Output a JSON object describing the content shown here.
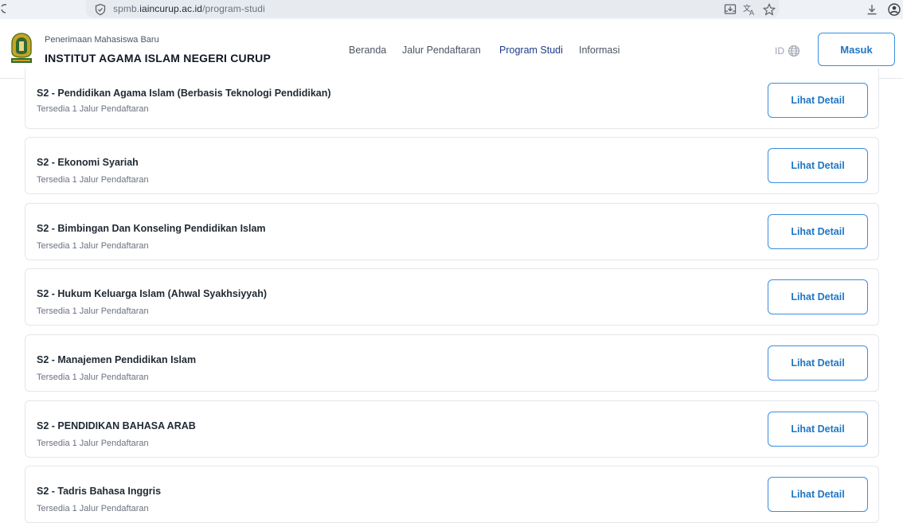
{
  "browser": {
    "url_prefix": "spmb.",
    "url_domain": "iaincurup.ac.id",
    "url_path": "/program-studi"
  },
  "header": {
    "subtitle": "Penerimaan Mahasiswa Baru",
    "brand": "INSTITUT AGAMA ISLAM NEGERI CURUP",
    "nav": [
      "Beranda",
      "Jalur Pendaftaran",
      "Program Studi",
      "Informasi"
    ],
    "active_nav": "Program Studi",
    "lang": "ID",
    "login_label": "Masuk"
  },
  "programs": [
    {
      "title": "S2 - Pendidikan Agama Islam (Berbasis Teknologi Pendidikan)",
      "subtitle": "Tersedia 1 Jalur Pendaftaran",
      "button": "Lihat Detail"
    },
    {
      "title": "S2 - Ekonomi Syariah",
      "subtitle": "Tersedia 1 Jalur Pendaftaran",
      "button": "Lihat Detail"
    },
    {
      "title": "S2 - Bimbingan Dan Konseling Pendidikan Islam",
      "subtitle": "Tersedia 1 Jalur Pendaftaran",
      "button": "Lihat Detail"
    },
    {
      "title": "S2 - Hukum Keluarga Islam (Ahwal Syakhsiyyah)",
      "subtitle": "Tersedia 1 Jalur Pendaftaran",
      "button": "Lihat Detail"
    },
    {
      "title": "S2 - Manajemen Pendidikan Islam",
      "subtitle": "Tersedia 1 Jalur Pendaftaran",
      "button": "Lihat Detail"
    },
    {
      "title": "S2 - PENDIDIKAN BAHASA ARAB",
      "subtitle": "Tersedia 1 Jalur Pendaftaran",
      "button": "Lihat Detail"
    },
    {
      "title": "S2 - Tadris Bahasa Inggris",
      "subtitle": "Tersedia 1 Jalur Pendaftaran",
      "button": "Lihat Detail"
    }
  ],
  "colors": {
    "accent": "#1f76c4",
    "nav_active": "#1e3a8a",
    "border": "#e3e6ea"
  }
}
